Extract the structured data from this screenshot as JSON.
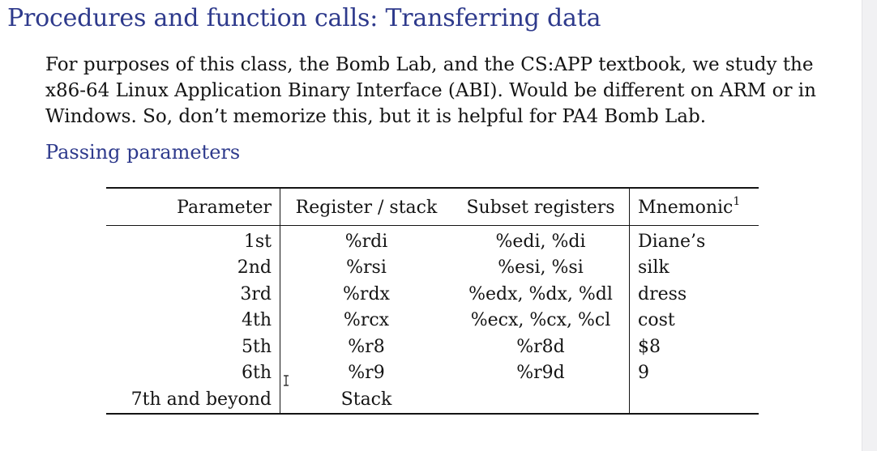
{
  "page": {
    "title": "Procedures and function calls: Transferring data",
    "intro": "For purposes of this class, the Bomb Lab, and the CS:APP textbook, we study the x86-64 Linux Application Binary Interface (ABI). Would be different on ARM or in Windows. So, don’t memorize this, but it is helpful for PA4 Bomb Lab.",
    "subheading": "Passing parameters"
  },
  "table": {
    "headers": {
      "parameter": "Parameter",
      "register": "Register / stack",
      "subset": "Subset registers",
      "mnemonic": "Mnemonic",
      "mnemonic_footnote": "1"
    },
    "rows": [
      {
        "parameter": "1st",
        "register": "%rdi",
        "subset": "%edi, %di",
        "mnemonic": "Diane’s"
      },
      {
        "parameter": "2nd",
        "register": "%rsi",
        "subset": "%esi, %si",
        "mnemonic": "silk"
      },
      {
        "parameter": "3rd",
        "register": "%rdx",
        "subset": "%edx, %dx, %dl",
        "mnemonic": "dress"
      },
      {
        "parameter": "4th",
        "register": "%rcx",
        "subset": "%ecx, %cx, %cl",
        "mnemonic": "cost"
      },
      {
        "parameter": "5th",
        "register": "%r8",
        "subset": "%r8d",
        "mnemonic": "$8"
      },
      {
        "parameter": "6th",
        "register": "%r9",
        "subset": "%r9d",
        "mnemonic": "9"
      },
      {
        "parameter": "7th and beyond",
        "register": "Stack",
        "subset": "",
        "mnemonic": ""
      }
    ]
  },
  "icons": {
    "cursor": "text-cursor-icon"
  },
  "colors": {
    "heading": "#2e3a8c",
    "text": "#141414",
    "background": "#ffffff"
  }
}
